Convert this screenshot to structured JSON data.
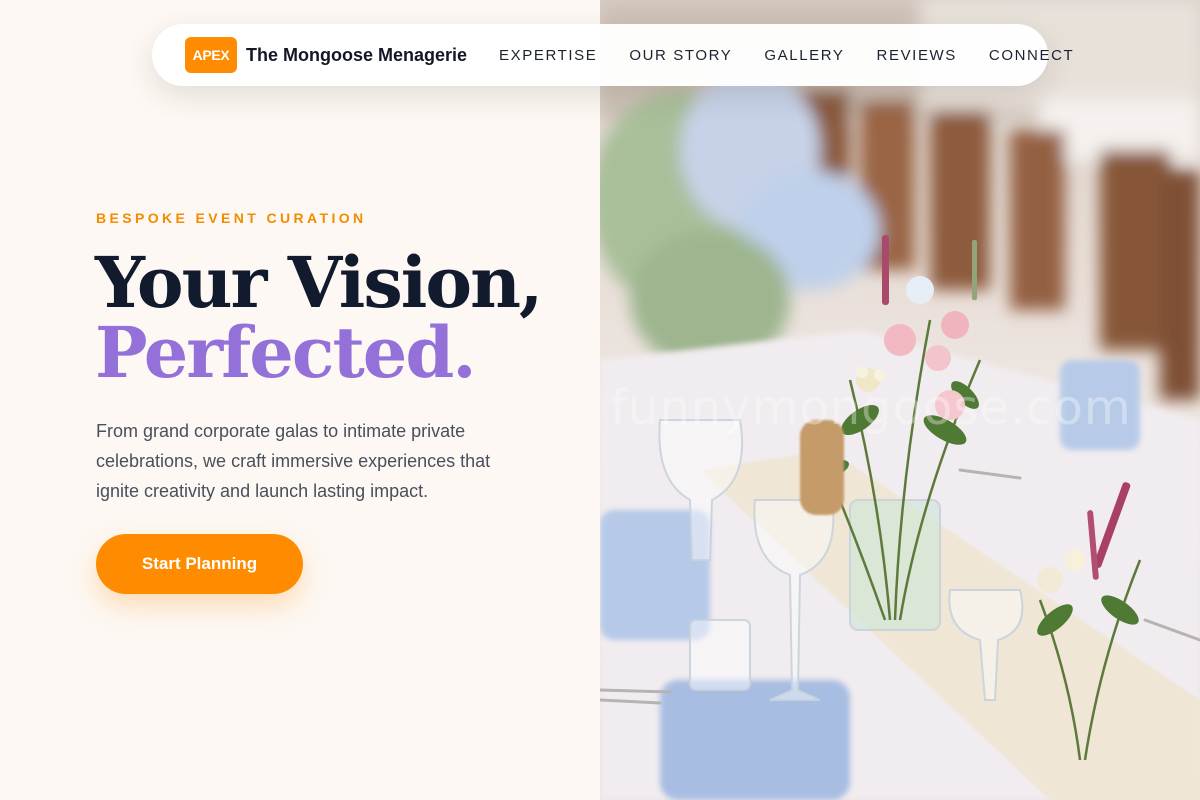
{
  "nav": {
    "logo_badge": "APEX",
    "brand_name": "The Mongoose Menagerie",
    "links": [
      "EXPERTISE",
      "OUR STORY",
      "GALLERY",
      "REVIEWS",
      "CONNECT"
    ]
  },
  "hero": {
    "eyebrow": "BESPOKE EVENT CURATION",
    "headline_line1": "Your Vision,",
    "headline_line2": "Perfected.",
    "subtext": "From grand corporate galas to intimate private celebrations, we craft immersive experiences that ignite creativity and launch lasting impact.",
    "cta_label": "Start Planning"
  },
  "photo": {
    "watermark": "funnymongoose.com"
  },
  "colors": {
    "accent": "#ff8c00",
    "headline_dark": "#121a2e",
    "headline_purple": "#9470d9",
    "page_bg": "#fdf8f3"
  }
}
